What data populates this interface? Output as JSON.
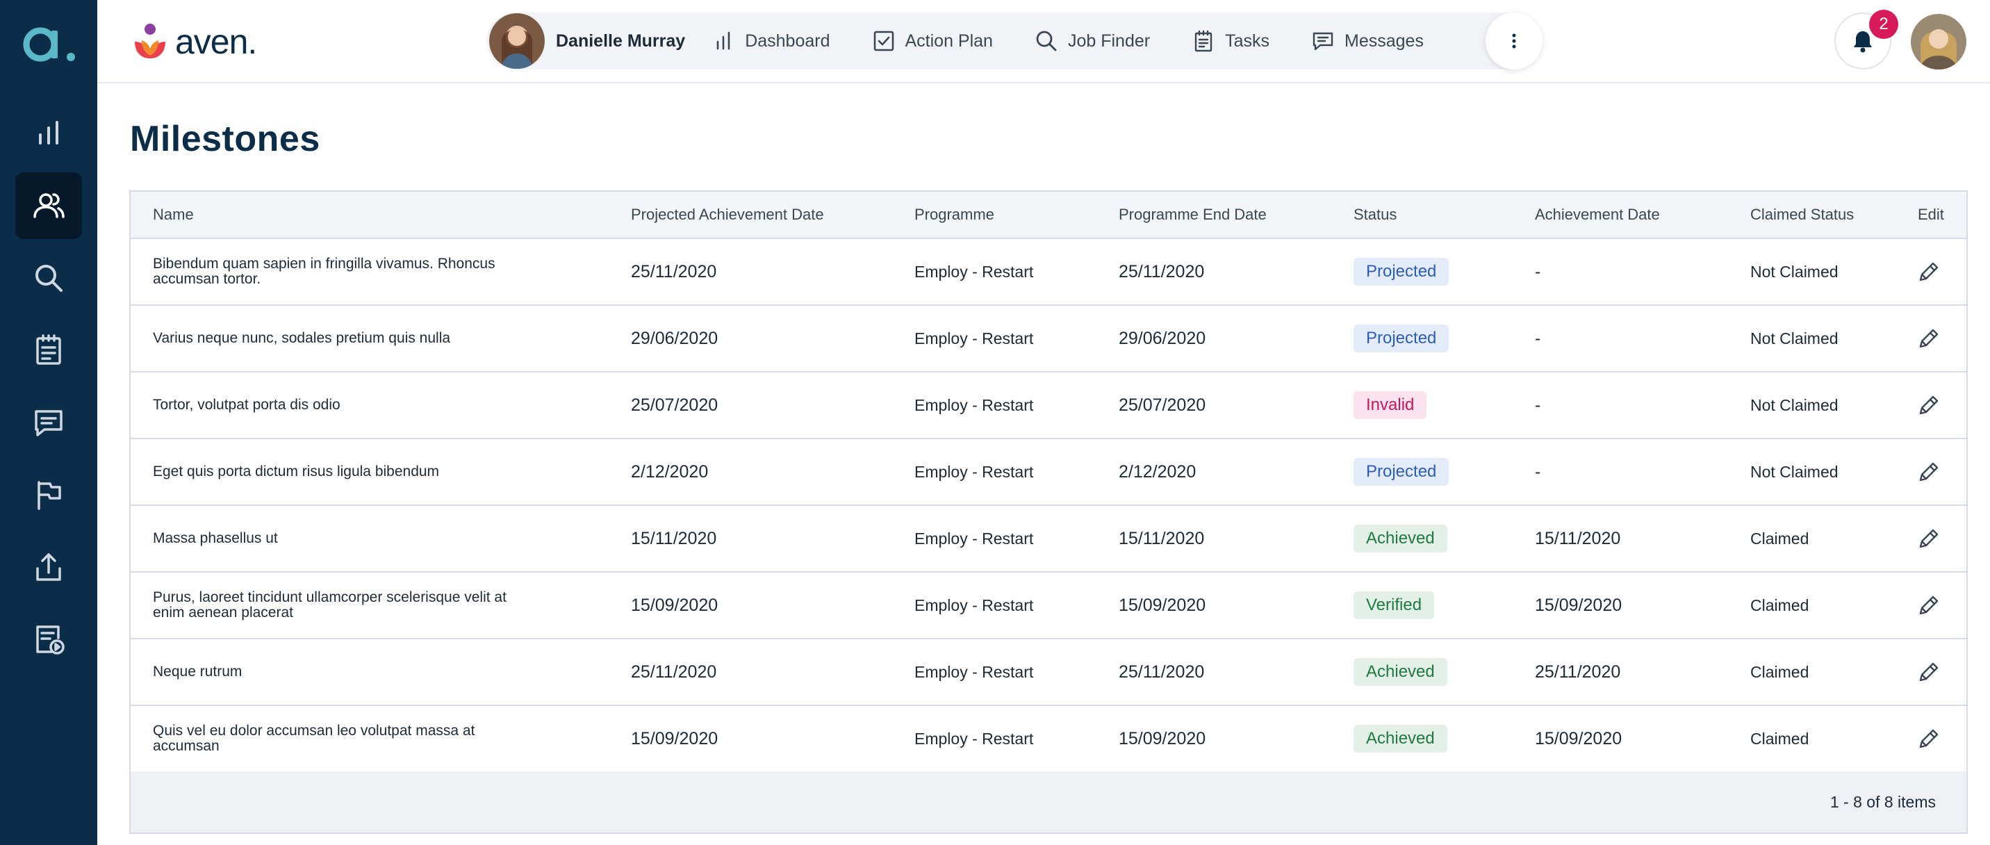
{
  "brand": {
    "name": "aven."
  },
  "sidebar": {
    "items": [
      {
        "icon": "bar-chart-icon",
        "active": false
      },
      {
        "icon": "users-icon",
        "active": true
      },
      {
        "icon": "search-icon",
        "active": false
      },
      {
        "icon": "clipboard-icon",
        "active": false
      },
      {
        "icon": "chat-icon",
        "active": false
      },
      {
        "icon": "flag-icon",
        "active": false
      },
      {
        "icon": "upload-icon",
        "active": false
      },
      {
        "icon": "document-play-icon",
        "active": false
      }
    ]
  },
  "nav": {
    "user_name": "Danielle Murray",
    "items": [
      {
        "label": "Dashboard",
        "icon": "bar-chart-icon"
      },
      {
        "label": "Action Plan",
        "icon": "checkbox-icon"
      },
      {
        "label": "Job Finder",
        "icon": "search-icon"
      },
      {
        "label": "Tasks",
        "icon": "clipboard-icon"
      },
      {
        "label": "Messages",
        "icon": "chat-icon"
      }
    ]
  },
  "notifications": {
    "count": "2"
  },
  "page": {
    "title": "Milestones"
  },
  "table": {
    "columns": [
      "Name",
      "Projected Achievement Date",
      "Programme",
      "Programme End Date",
      "Status",
      "Achievement Date",
      "Claimed Status",
      "Edit"
    ],
    "rows": [
      {
        "name": "Bibendum quam sapien in fringilla vivamus. Rhoncus accumsan tortor.",
        "projected": "25/11/2020",
        "programme": "Employ - Restart",
        "end": "25/11/2020",
        "status": "Projected",
        "status_kind": "projected",
        "achieved": "-",
        "claimed": "Not Claimed"
      },
      {
        "name": "Varius neque nunc, sodales pretium quis nulla",
        "projected": "29/06/2020",
        "programme": "Employ - Restart",
        "end": "29/06/2020",
        "status": "Projected",
        "status_kind": "projected",
        "achieved": "-",
        "claimed": "Not Claimed"
      },
      {
        "name": "Tortor, volutpat porta dis odio",
        "projected": "25/07/2020",
        "programme": "Employ - Restart",
        "end": "25/07/2020",
        "status": "Invalid",
        "status_kind": "invalid",
        "achieved": "-",
        "claimed": "Not Claimed"
      },
      {
        "name": "Eget quis porta dictum risus ligula bibendum",
        "projected": "2/12/2020",
        "programme": "Employ - Restart",
        "end": "2/12/2020",
        "status": "Projected",
        "status_kind": "projected",
        "achieved": "-",
        "claimed": "Not Claimed"
      },
      {
        "name": "Massa phasellus ut",
        "projected": "15/11/2020",
        "programme": "Employ - Restart",
        "end": "15/11/2020",
        "status": "Achieved",
        "status_kind": "achieved",
        "achieved": "15/11/2020",
        "claimed": "Claimed"
      },
      {
        "name": "Purus, laoreet tincidunt ullamcorper scelerisque velit at enim aenean placerat",
        "projected": "15/09/2020",
        "programme": "Employ - Restart",
        "end": "15/09/2020",
        "status": "Verified",
        "status_kind": "verified",
        "achieved": "15/09/2020",
        "claimed": "Claimed"
      },
      {
        "name": "Neque rutrum",
        "projected": "25/11/2020",
        "programme": "Employ - Restart",
        "end": "25/11/2020",
        "status": "Achieved",
        "status_kind": "achieved",
        "achieved": "25/11/2020",
        "claimed": "Claimed"
      },
      {
        "name": "Quis vel eu dolor accumsan leo volutpat massa at accumsan",
        "projected": "15/09/2020",
        "programme": "Employ - Restart",
        "end": "15/09/2020",
        "status": "Achieved",
        "status_kind": "achieved",
        "achieved": "15/09/2020",
        "claimed": "Claimed"
      }
    ],
    "pagination": "1 - 8 of 8 items"
  },
  "colors": {
    "sidebar": "#0b2d48",
    "sidebar_active": "#06192a",
    "accent_teal": "#4fb6c6",
    "badge": "#d7195a"
  }
}
